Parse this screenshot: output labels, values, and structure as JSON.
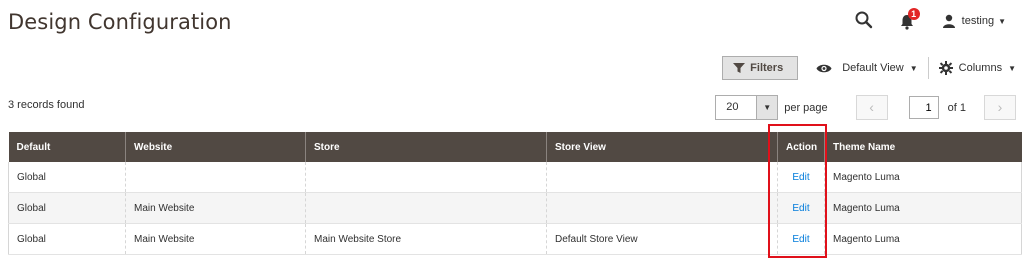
{
  "page": {
    "title": "Design Configuration"
  },
  "header": {
    "notifications_count": "1",
    "user_name": "testing"
  },
  "toolbar": {
    "filters_label": "Filters",
    "view_label": "Default View",
    "columns_label": "Columns"
  },
  "records": {
    "found_text": "3 records found"
  },
  "pager": {
    "per_page_value": "20",
    "per_page_label": "per page",
    "current_page": "1",
    "of_label": "of 1"
  },
  "grid": {
    "headers": [
      "Default",
      "Website",
      "Store",
      "Store View",
      "Action",
      "Theme Name"
    ],
    "rows": [
      {
        "default": "Global",
        "website": "",
        "store": "",
        "store_view": "",
        "action": "Edit",
        "theme": "Magento Luma"
      },
      {
        "default": "Global",
        "website": "Main Website",
        "store": "",
        "store_view": "",
        "action": "Edit",
        "theme": "Magento Luma"
      },
      {
        "default": "Global",
        "website": "Main Website",
        "store": "Main Website Store",
        "store_view": "Default Store View",
        "action": "Edit",
        "theme": "Magento Luma"
      }
    ]
  },
  "colors": {
    "header_bg": "#514943",
    "link": "#007bdb",
    "highlight": "#e0101a",
    "badge": "#e22626"
  }
}
